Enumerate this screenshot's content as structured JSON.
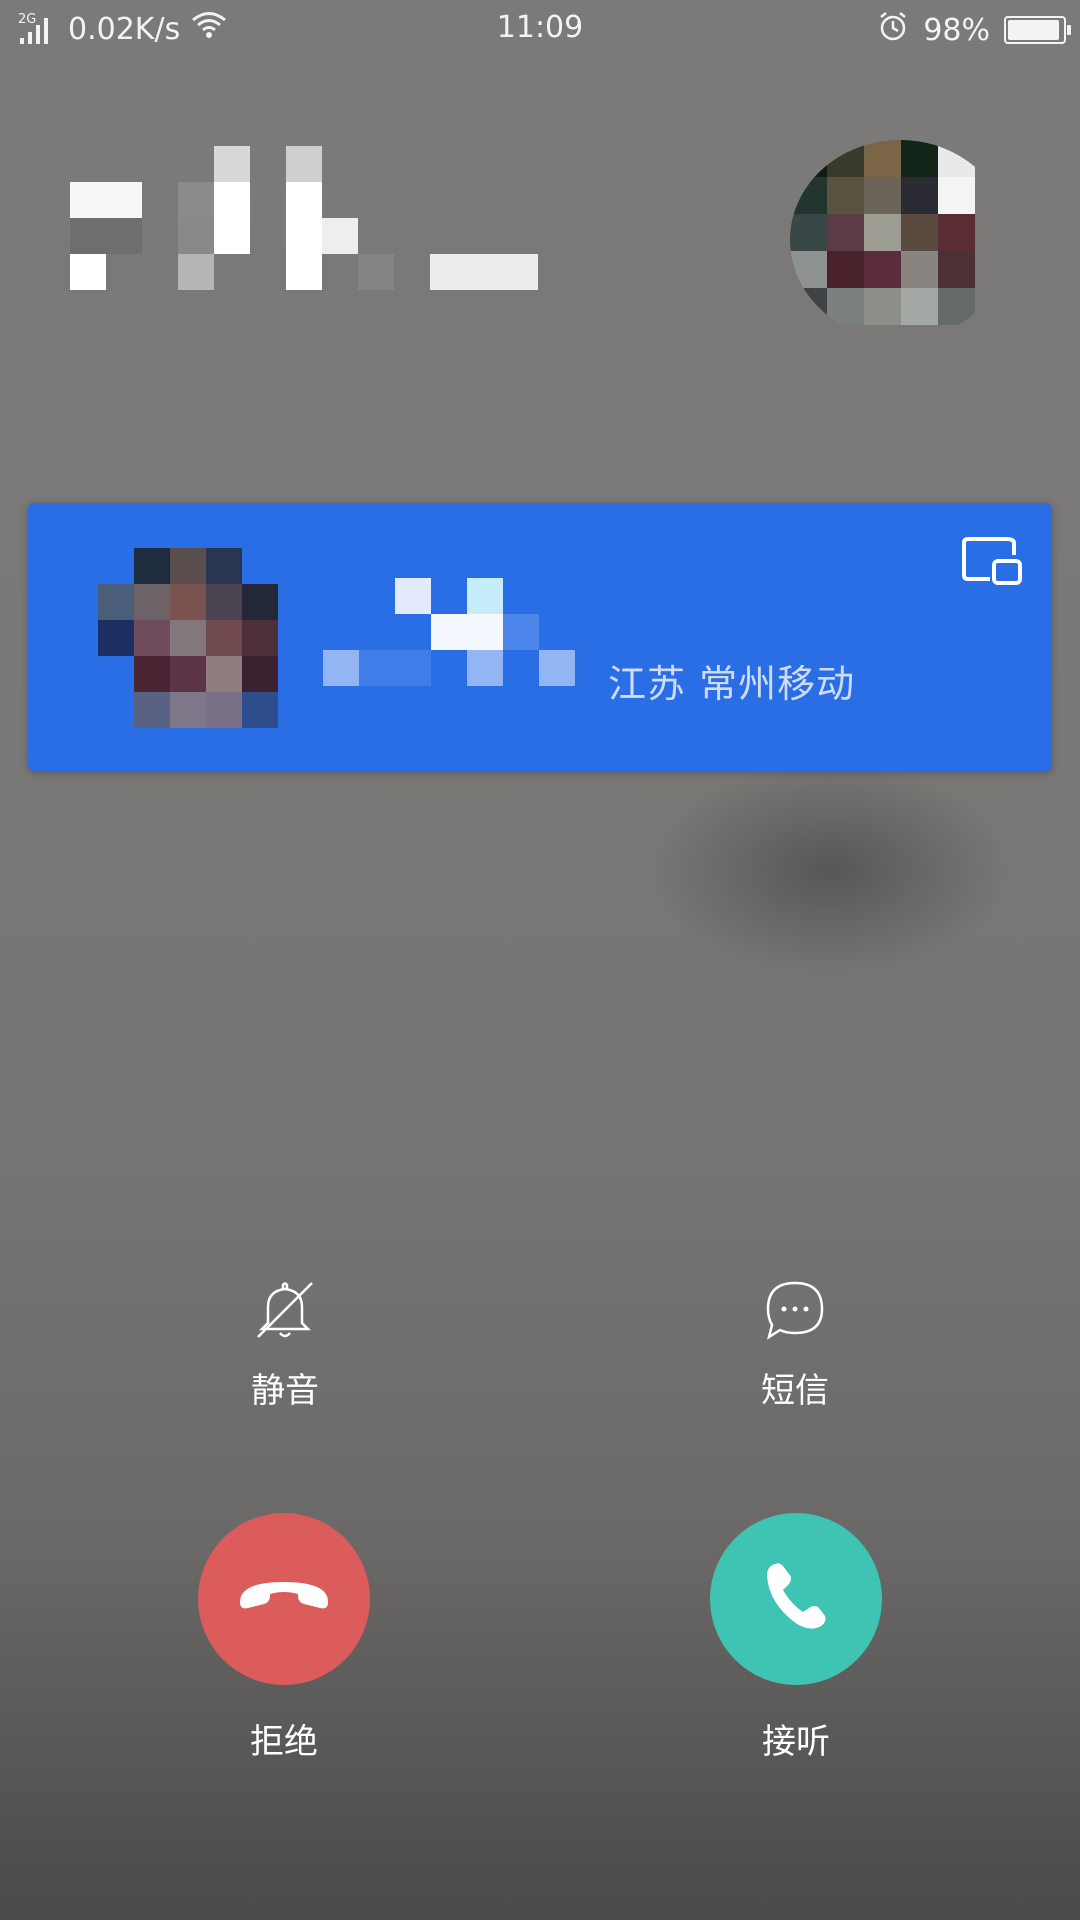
{
  "status_bar": {
    "network_type": "2G",
    "net_speed": "0.02K/s",
    "time": "11:09",
    "battery_percent": "98%",
    "battery_level": 0.98,
    "icons": [
      "signal-icon",
      "wifi-icon",
      "alarm-icon",
      "battery-icon"
    ]
  },
  "caller": {
    "name": "",
    "avatar": "avatar-pixelated"
  },
  "incoming_card": {
    "name": "",
    "location": "江苏 常州移动",
    "pip_icon": "picture-in-picture-icon"
  },
  "actions": {
    "mute": {
      "label": "静音",
      "icon": "bell-off-icon"
    },
    "sms": {
      "label": "短信",
      "icon": "chat-bubble-icon"
    }
  },
  "call_buttons": {
    "decline": {
      "label": "拒绝",
      "icon": "phone-hangup-icon",
      "color": "#dc5c5c"
    },
    "accept": {
      "label": "接听",
      "icon": "phone-icon",
      "color": "#3fc4b4"
    }
  }
}
